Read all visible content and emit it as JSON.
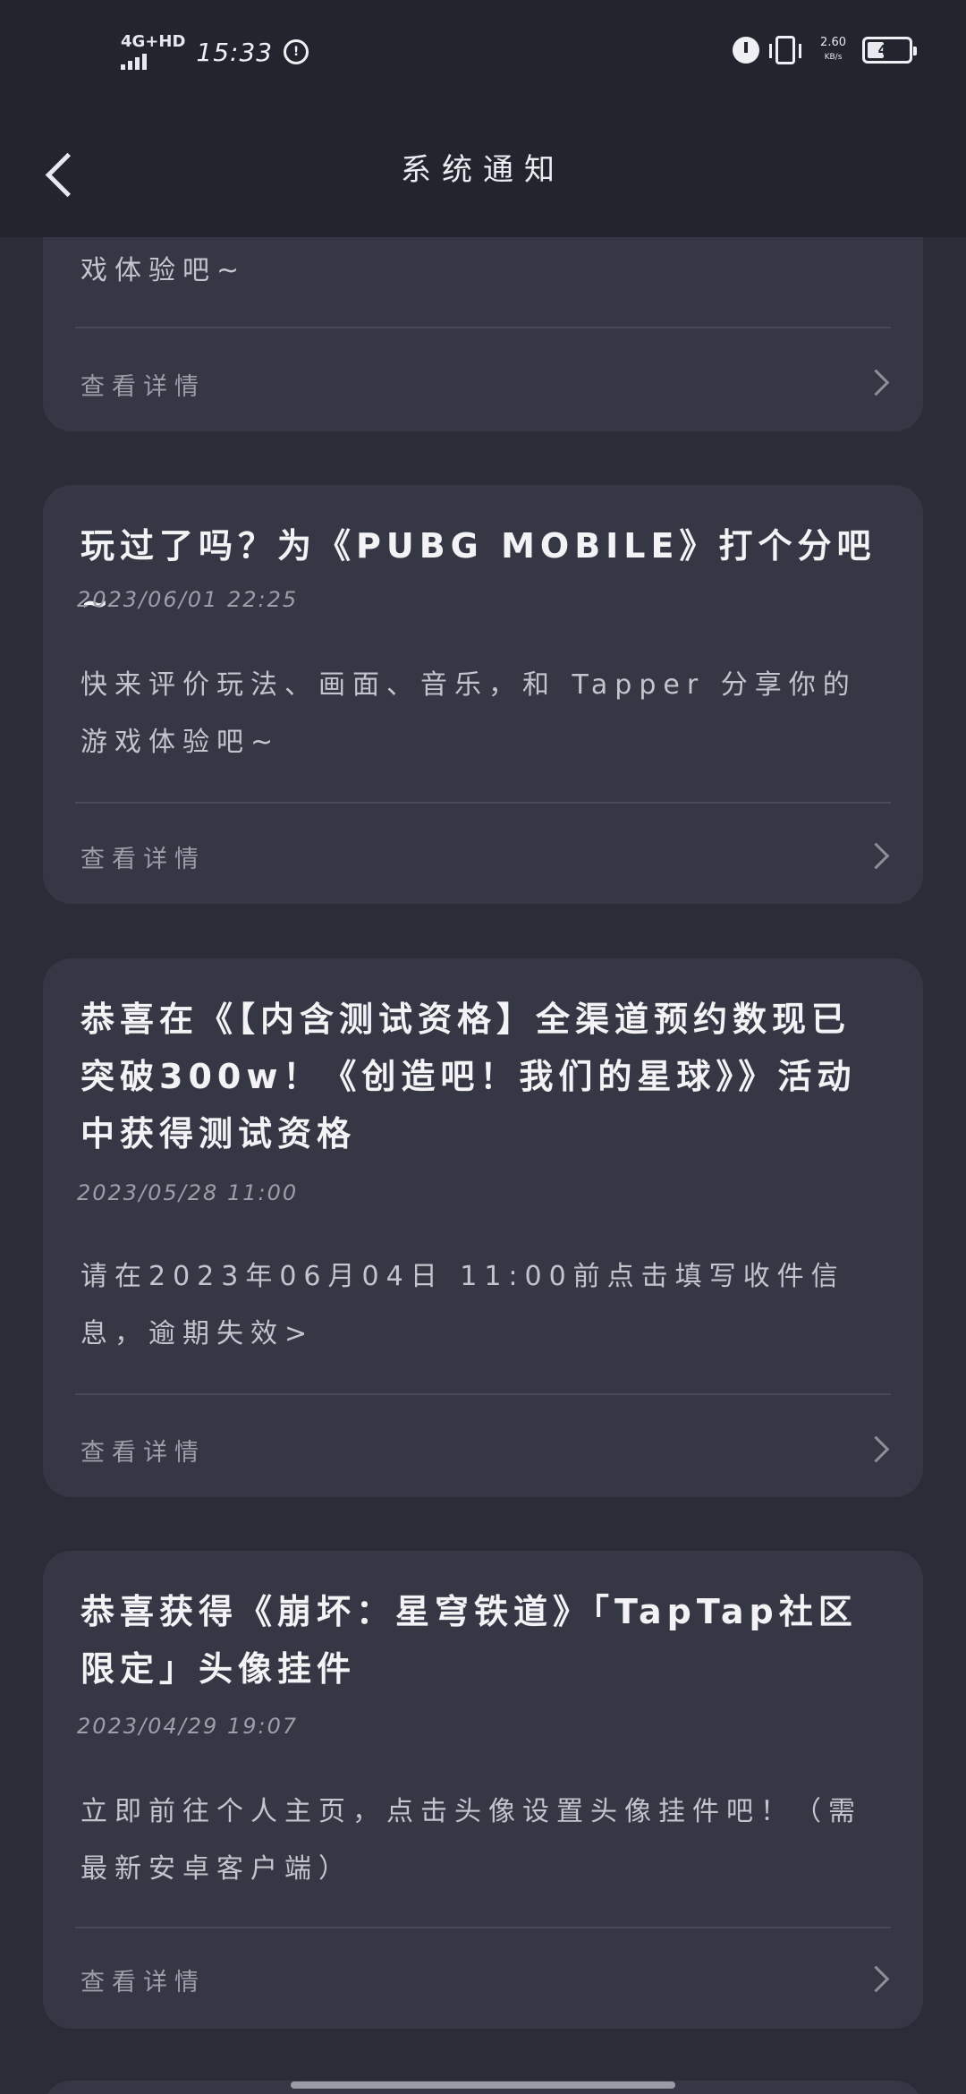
{
  "status_bar": {
    "network": "4G+HD",
    "time": "15:33",
    "net_speed": "2.60",
    "net_speed_unit": "KB/s",
    "battery": "42",
    "battery_level": 0.42
  },
  "header": {
    "title": "系统通知"
  },
  "notifications": [
    {
      "body_tail": "戏体验吧~",
      "detail_label": "查看详情"
    },
    {
      "title": "玩过了吗？为《PUBG MOBILE》打个分吧~",
      "date": "2023/06/01 22:25",
      "body": "快来评价玩法、画面、音乐，和 Tapper 分享你的游戏体验吧~",
      "detail_label": "查看详情"
    },
    {
      "title": "恭喜在《【内含测试资格】全渠道预约数现已突破300w！《创造吧！我们的星球》》活动中获得测试资格",
      "date": "2023/05/28 11:00",
      "body": "请在2023年06月04日 11:00前点击填写收件信息，逾期失效>",
      "detail_label": "查看详情"
    },
    {
      "title": "恭喜获得《崩坏：星穹铁道》「TapTap社区限定」头像挂件",
      "date": "2023/04/29 19:07",
      "body": "立即前往个人主页，点击头像设置头像挂件吧！（需最新安卓客户端）",
      "detail_label": "查看详情"
    }
  ]
}
